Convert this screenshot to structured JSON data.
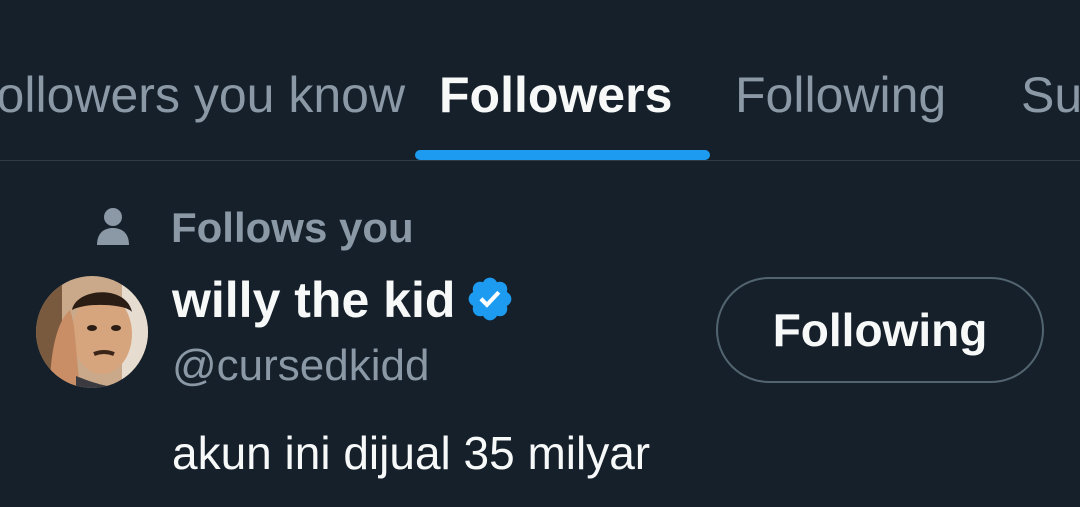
{
  "tabs": [
    {
      "label": "Followers you know",
      "active": false
    },
    {
      "label": "Followers",
      "active": true
    },
    {
      "label": "Following",
      "active": false
    },
    {
      "label": "Subscriptions",
      "active": false
    }
  ],
  "user_row": {
    "social_context": "Follows you",
    "display_name": "willy the kid",
    "verified": true,
    "handle": "@cursedkidd",
    "follow_button_label": "Following",
    "bio": "akun ini dijual 35 milyar"
  },
  "colors": {
    "background": "#15202b",
    "accent": "#1d9bf0",
    "primary_text": "#f7f9f9",
    "secondary_text": "#8b98a5",
    "verified_badge": "#1d9bf0"
  },
  "icons": {
    "social_context": "person-icon",
    "verified": "verified-badge-icon"
  }
}
